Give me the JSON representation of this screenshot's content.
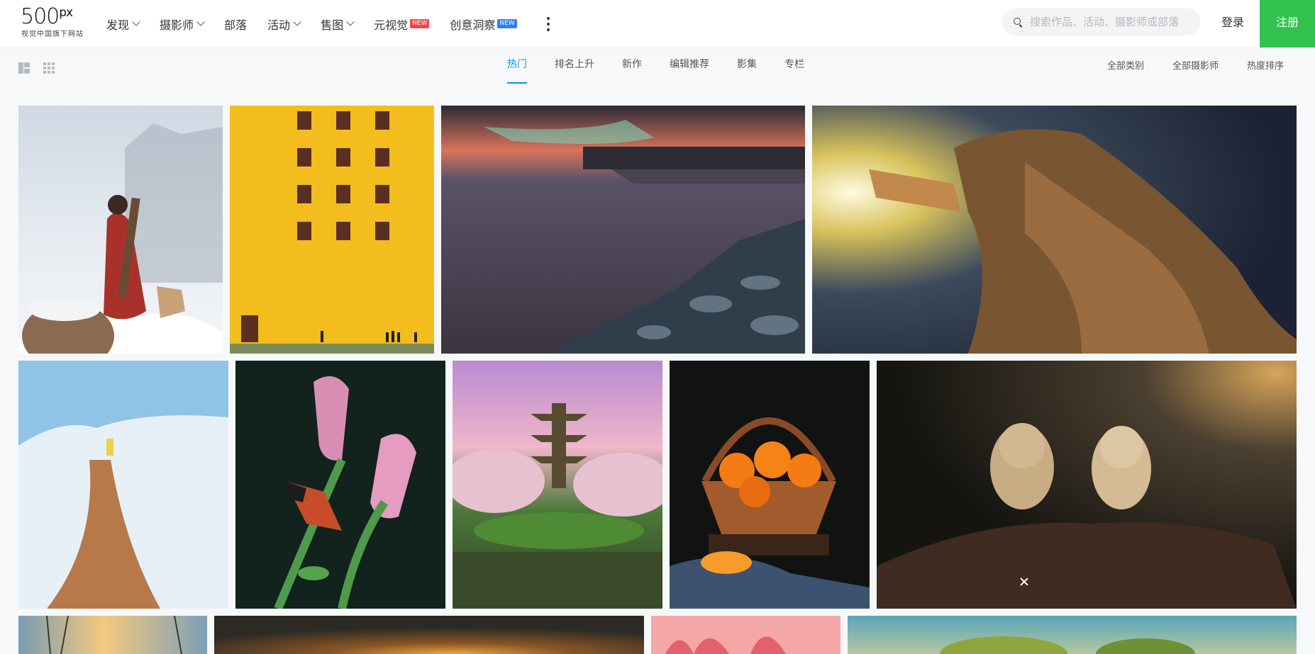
{
  "logo": {
    "mark": "500",
    "mark_sup": "px",
    "tagline": "视觉中国旗下网站"
  },
  "nav": [
    {
      "label": "发现",
      "dropdown": true
    },
    {
      "label": "摄影师",
      "dropdown": true
    },
    {
      "label": "部落",
      "dropdown": false
    },
    {
      "label": "活动",
      "dropdown": true
    },
    {
      "label": "售图",
      "dropdown": true
    },
    {
      "label": "元视觉",
      "badge": "NEW",
      "badge_color": "#f0474d"
    },
    {
      "label": "创意洞察",
      "badge": "NEW",
      "badge_color": "#2f7ef2"
    }
  ],
  "search": {
    "placeholder": "搜索作品、活动、摄影师或部落"
  },
  "auth": {
    "login": "登录",
    "signup": "注册"
  },
  "tabs": [
    {
      "label": "热门",
      "active": true
    },
    {
      "label": "排名上升"
    },
    {
      "label": "新作"
    },
    {
      "label": "编辑推荐"
    },
    {
      "label": "影集"
    },
    {
      "label": "专栏"
    }
  ],
  "filters": [
    "全部类别",
    "全部摄影师",
    "热度排序"
  ],
  "colors": {
    "accent": "#0f90e6",
    "signup": "#32c250"
  },
  "photos": {
    "row1": [
      "woman-with-guqin-and-dog-in-snow",
      "yellow-building-facade",
      "sunset-seashore-rocks",
      "golden-robed-figure-with-light"
    ],
    "row2": [
      "white-curved-path-person",
      "butterfly-on-pink-flower",
      "pagoda-with-cherry-blossoms",
      "orange-fruit-basket",
      "two-owls-on-dirt-mound"
    ],
    "row3": [
      "sunset-willow",
      "warm-sunset-glow",
      "pink-dahlia",
      "tree-landscape"
    ]
  }
}
